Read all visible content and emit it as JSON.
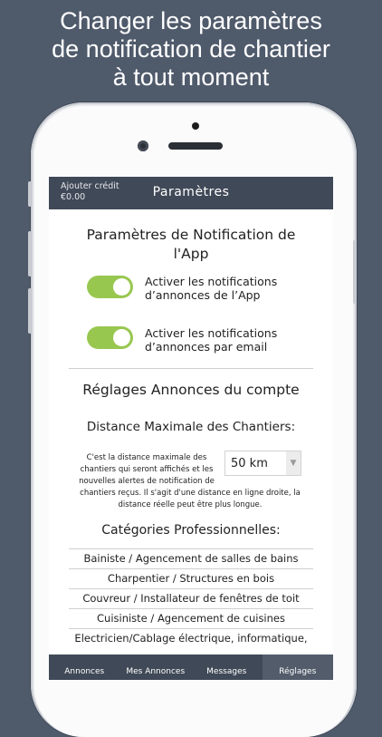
{
  "promo": {
    "line1": "Changer les paramètres",
    "line2": "de notification de chantier",
    "line3": "à tout moment"
  },
  "header": {
    "credit_label": "Ajouter crédit",
    "credit_amount": "€0.00",
    "title": "Paramètres"
  },
  "notifications": {
    "title": "Paramètres de Notification de l'App",
    "app_toggle": {
      "label_line1": "Activer les notifications",
      "label_line2": "d’annonces de l’App",
      "on": true
    },
    "email_toggle": {
      "label_line1": "Activer les notifications",
      "label_line2": "d’annonces par email",
      "on": true
    }
  },
  "account": {
    "title": "Réglages Annonces du compte",
    "distance_title": "Distance Maximale des Chantiers:",
    "distance_desc": {
      "line1": "C'est la distance maximale des",
      "line2": "chantiers qui seront affichés et les",
      "line3": "nouvelles alertes de notification de",
      "line4": "chantiers reçus. Il s'agit d'une distance en ligne droite, la",
      "line5": "distance réelle peut être plus longue."
    },
    "distance_value": "50 km",
    "categories_title": "Catégories Professionnelles:",
    "categories": [
      "Bainiste / Agencement de salles de bains",
      "Charpentier / Structures en bois",
      "Couvreur / Installateur de fenêtres de toit",
      "Cuisiniste / Agencement de cuisines",
      "Electricien/Cablage électrique, informatique,"
    ]
  },
  "tabs": [
    {
      "label": "Annonces",
      "active": false
    },
    {
      "label": "Mes Annonces",
      "active": false
    },
    {
      "label": "Messages",
      "active": false
    },
    {
      "label": "Réglages",
      "active": true
    }
  ],
  "colors": {
    "background": "#4f5a6b",
    "bar": "#404957",
    "toggle_on": "#98c750"
  }
}
